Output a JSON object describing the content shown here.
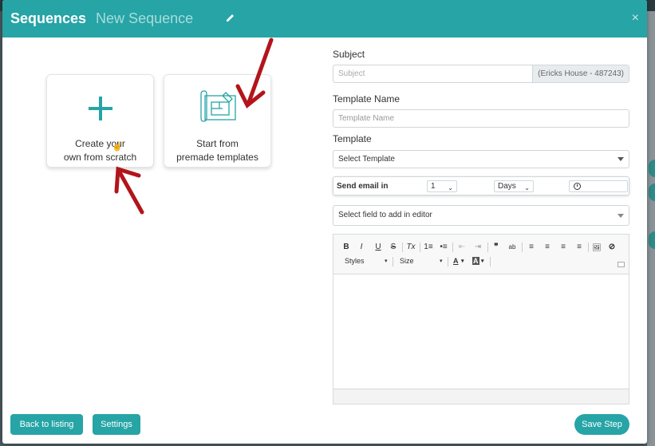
{
  "header": {
    "title": "Sequences",
    "subtitle": "New Sequence",
    "edit_icon": "pencil-icon",
    "close_label": "×"
  },
  "cards": [
    {
      "label": "Create your\nown from scratch",
      "icon": "plus-icon"
    },
    {
      "label": "Start from\npremade templates",
      "icon": "blueprint-icon"
    }
  ],
  "form": {
    "subject_label": "Subject",
    "subject_placeholder": "Subject",
    "subject_addon": "(Ericks House - 487243)",
    "template_name_label": "Template Name",
    "template_name_placeholder": "Template Name",
    "template_label": "Template",
    "template_select": "Select Template",
    "send_email_label": "Send email in",
    "send_amount": "1",
    "send_unit": "Days",
    "field_select": "Select field to add in editor"
  },
  "editor": {
    "toolbar_buttons": [
      "B",
      "I",
      "U",
      "S",
      "Tx",
      "1≡",
      "•≡",
      "⇤",
      "⇥",
      "❞",
      "ab",
      "≡",
      "≡",
      "≡",
      "≡",
      "🖼",
      "⊘"
    ],
    "styles_combo": "Styles",
    "size_combo": "Size",
    "text_color": "A",
    "bg_color": "A"
  },
  "footer": {
    "back_button": "Back to listing",
    "settings_button": "Settings",
    "save_button": "Save Step"
  },
  "colors": {
    "accent": "#26a4a6",
    "arrow": "#b3141b"
  }
}
